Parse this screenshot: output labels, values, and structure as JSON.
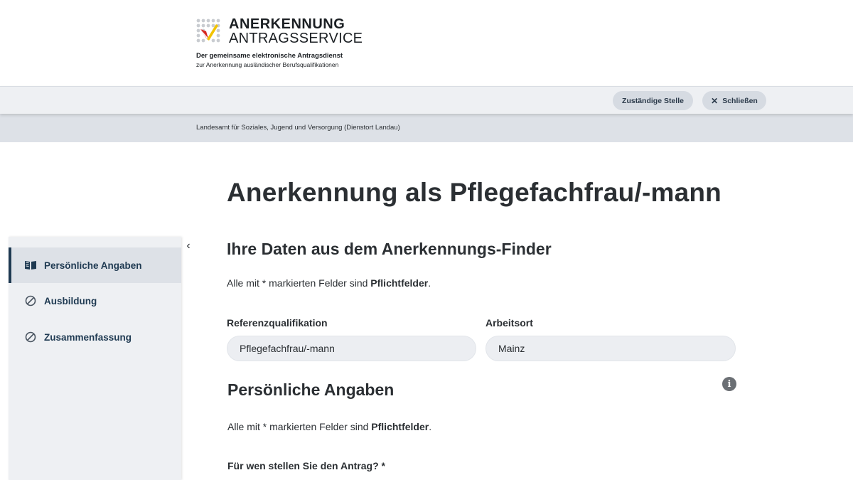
{
  "header": {
    "logo_line1": "ANERKENNUNG",
    "logo_line2": "ANTRAGSSERVICE",
    "tagline": "Der gemeinsame elektronische Antragsdienst",
    "subtagline": "zur Anerkennung ausländischer Berufsqualifikationen"
  },
  "toolbar": {
    "authority_button": "Zuständige Stelle",
    "close_icon": "✕",
    "close_button": "Schließen"
  },
  "authority_name": "Landesamt für Soziales, Jugend und Versorgung (Dienstort Landau)",
  "page_title": "Anerkennung als Pflegefachfrau/-mann",
  "sidebar": {
    "collapse_icon": "‹",
    "items": [
      {
        "label": "Persönliche Angaben",
        "icon": "open-book-icon",
        "active": true
      },
      {
        "label": "Ausbildung",
        "icon": "not-started-icon",
        "active": false
      },
      {
        "label": "Zusammenfassung",
        "icon": "not-started-icon",
        "active": false
      }
    ]
  },
  "finder_section": {
    "heading": "Ihre Daten aus dem Anerkennungs-Finder",
    "note_prefix": "Alle mit * markierten Felder sind ",
    "note_bold": "Pflichtfelder",
    "note_suffix": ".",
    "reference_label": "Referenzqualifikation",
    "reference_value": "Pflegefachfrau/-mann",
    "workplace_label": "Arbeitsort",
    "workplace_value": "Mainz"
  },
  "personal_section": {
    "heading": "Persönliche Angaben",
    "info_icon": "i",
    "note_prefix": "Alle mit * markierten Felder sind ",
    "note_bold": "Pflichtfelder",
    "note_suffix": ".",
    "question": "Für wen stellen Sie den Antrag? *"
  },
  "colors": {
    "nav_text": "#1f3a52",
    "button_bg": "#d6dbe2",
    "toolbar_bg": "#eef0f3",
    "authority_bg": "#dde1e7",
    "logo_red": "#d7261e",
    "logo_yellow": "#f2c300"
  }
}
